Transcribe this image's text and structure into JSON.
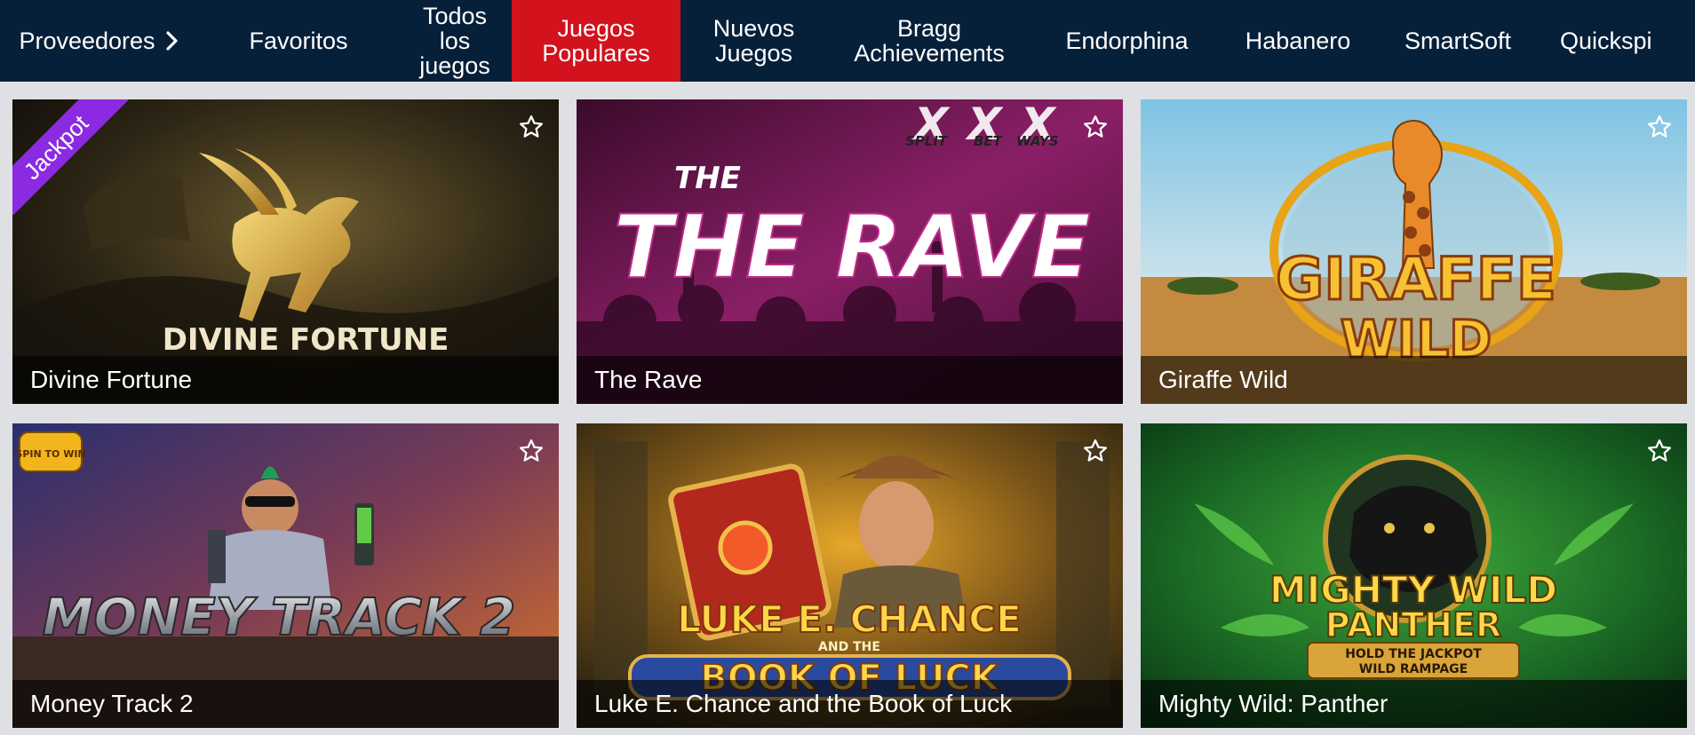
{
  "nav": {
    "items": [
      {
        "label": "Proveedores",
        "has_chevron": true
      },
      {
        "label": "Favoritos"
      },
      {
        "label": "Todos\nlos\njuegos"
      },
      {
        "label": "Juegos\nPopulares",
        "active": true
      },
      {
        "label": "Nuevos\nJuegos"
      },
      {
        "label": "Bragg\nAchievements"
      },
      {
        "label": "Endorphina"
      },
      {
        "label": "Habanero"
      },
      {
        "label": "SmartSoft"
      },
      {
        "label": "Quickspi"
      }
    ]
  },
  "games": [
    {
      "title": "Divine Fortune",
      "art_text": "DIVINE FORTUNE",
      "badge": "Jackpot"
    },
    {
      "title": "The Rave",
      "art_text": "THE RAVE",
      "feature_marks": [
        "SPLIT",
        "BET",
        "WAYS"
      ]
    },
    {
      "title": "Giraffe Wild",
      "art_text_1": "GIRAFFE",
      "art_text_2": "WILD"
    },
    {
      "title": "Money Track 2",
      "art_text": "MONEY TRACK 2",
      "corner_badge": "SPIN TO WIN"
    },
    {
      "title": "Luke E. Chance and the Book of Luck",
      "art_text_1": "LUKE E. CHANCE",
      "art_text_2": "AND THE",
      "art_text_3": "BOOK OF LUCK"
    },
    {
      "title": "Mighty Wild: Panther",
      "art_text_1": "MIGHTY WILD",
      "art_text_2": "PANTHER",
      "art_text_3": "HOLD THE JACKPOT",
      "art_text_4": "WILD RAMPAGE"
    }
  ],
  "colors": {
    "nav_bg": "#07203a",
    "active_tab": "#d2121d",
    "jackpot_ribbon": "#8a2be2",
    "page_bg": "#dfe0e3"
  },
  "icons": {
    "favorite": "star-outline-icon",
    "chevron": "chevron-right-icon"
  }
}
